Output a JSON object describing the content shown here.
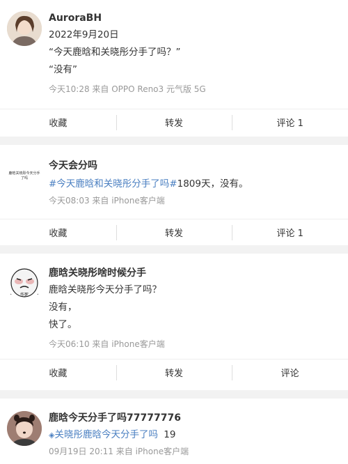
{
  "posts": [
    {
      "name": "AuroraBH",
      "lines": [
        "2022年9月20日",
        "“今天鹿晗和关晓彤分手了吗？”",
        "“没有”"
      ],
      "meta": "今天10:28  来自 OPPO Reno3 元气版 5G",
      "actions": {
        "collect": "收藏",
        "repost": "转发",
        "comment": "评论 1"
      }
    },
    {
      "name": "今天会分吗",
      "avatar_text": "鹿晗关晓彤今天分手了吗",
      "hashtag": "#今天鹿晗和关晓彤分手了吗#",
      "hashtag_suffix": "1809天，没有。",
      "meta": "今天08:03  来自 iPhone客户端",
      "actions": {
        "collect": "收藏",
        "repost": "转发",
        "comment": "评论 1"
      }
    },
    {
      "name": "鹿晗关晓彤啥时候分手",
      "lines": [
        "鹿晗关晓彤今天分手了吗？",
        "没有，",
        "快了。"
      ],
      "meta": "今天06:10  来自 iPhone客户端",
      "actions": {
        "collect": "收藏",
        "repost": "转发",
        "comment": "评论"
      }
    },
    {
      "name": "鹿晗今天分手了吗77777776",
      "topic": "关晓彤鹿晗今天分手了吗",
      "topic_count": "19",
      "meta": "09月19日 20:11  来自 iPhone客户端"
    }
  ],
  "colors": {
    "link": "#4a7fc1",
    "meta": "#999999",
    "background": "#f2f2f2"
  }
}
